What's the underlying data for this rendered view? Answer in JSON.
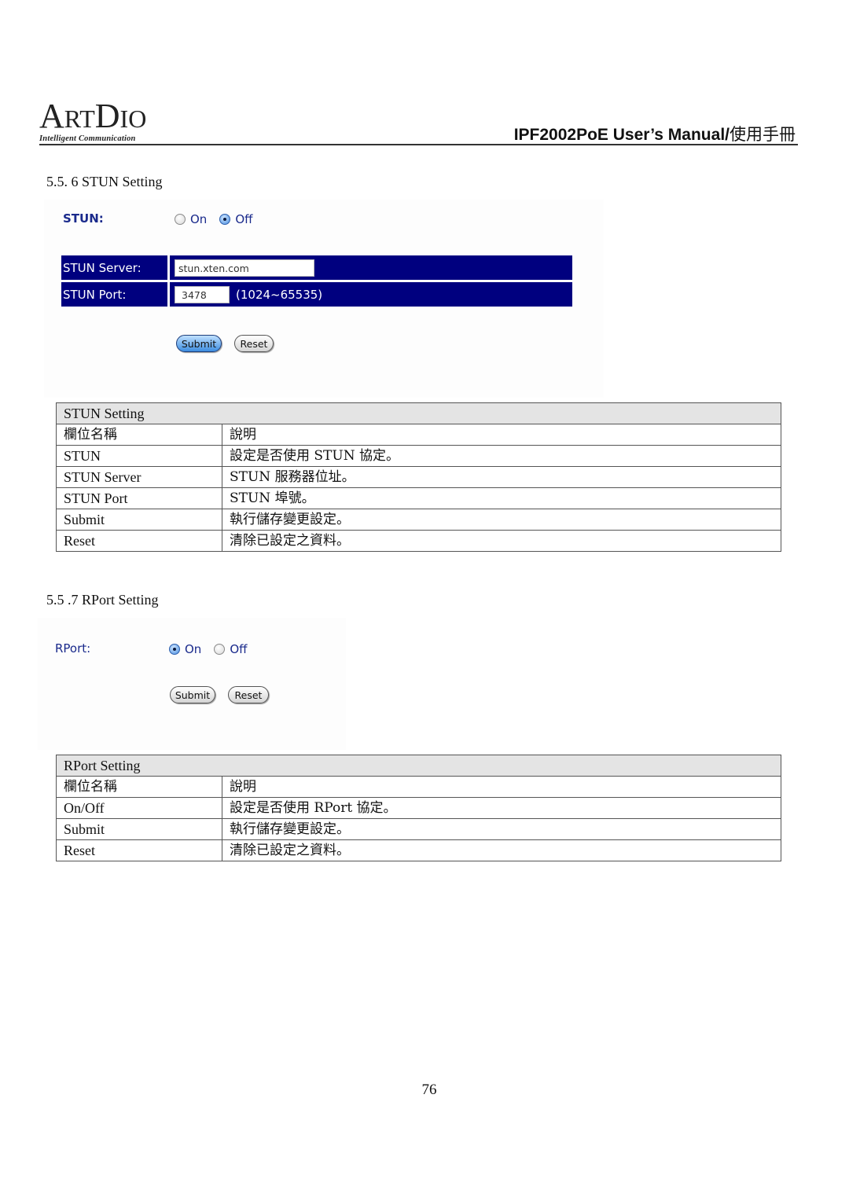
{
  "header": {
    "logo": {
      "text_big_1": "A",
      "text_small_1": "RT",
      "text_big_2": "D",
      "text_small_2": "IO",
      "tagline": "Intelligent Communication"
    },
    "manual_title_latin": "IPF2002PoE User’s Manual/",
    "manual_title_cjk": "使用手冊"
  },
  "stun_section": {
    "heading": "5.5. 6 STUN Setting",
    "screenshot": {
      "stun_label": "STUN:",
      "options": [
        {
          "label": "On",
          "checked": false
        },
        {
          "label": "Off",
          "checked": true
        }
      ],
      "server_label": "STUN Server:",
      "server_value": "stun.xten.com",
      "port_label": "STUN Port:",
      "port_value": "3478",
      "port_range": "(1024~65535)",
      "submit_label": "Submit",
      "reset_label": "Reset",
      "colors": {
        "row_bg": "#00007f",
        "label_text": "#1a2a8c"
      }
    },
    "table": {
      "title": "STUN Setting",
      "header": [
        "欄位名稱",
        "說明"
      ],
      "rows": [
        [
          "STUN",
          "設定是否使用 STUN 協定。"
        ],
        [
          "STUN Server",
          "STUN 服務器位址。"
        ],
        [
          "STUN Port",
          "STUN 埠號。"
        ],
        [
          "Submit",
          "執行儲存變更設定。"
        ],
        [
          "Reset",
          "清除已設定之資料。"
        ]
      ]
    }
  },
  "rport_section": {
    "heading": "5.5 .7 RPort Setting",
    "screenshot": {
      "rport_label": "RPort:",
      "options": [
        {
          "label": "On",
          "checked": true
        },
        {
          "label": "Off",
          "checked": false
        }
      ],
      "submit_label": "Submit",
      "reset_label": "Reset"
    },
    "table": {
      "title": "RPort Setting",
      "header": [
        "欄位名稱",
        "說明"
      ],
      "rows": [
        [
          "On/Off",
          "設定是否使用 RPort 協定。"
        ],
        [
          "Submit",
          "執行儲存變更設定。"
        ],
        [
          "Reset",
          "清除已設定之資料。"
        ]
      ]
    }
  },
  "footer": {
    "page_number": "76"
  }
}
